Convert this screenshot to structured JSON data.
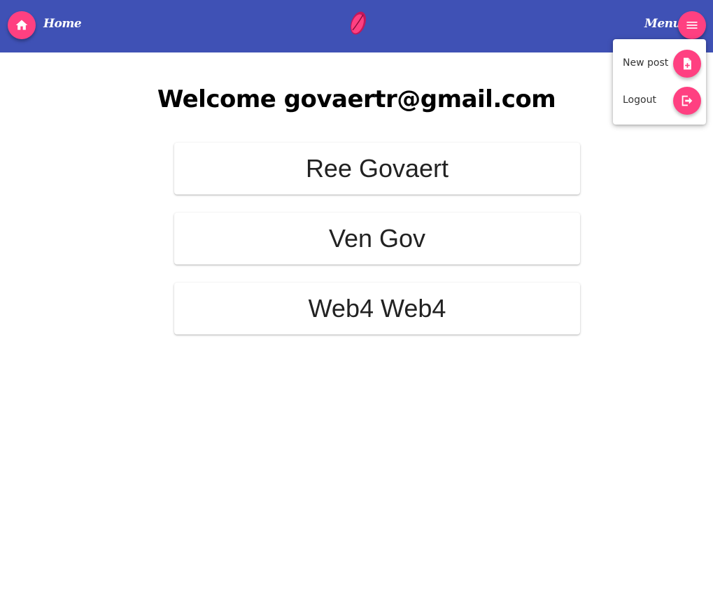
{
  "header": {
    "home_label": "Home",
    "menu_label": "Menu",
    "home_icon": "home-icon",
    "menu_icon": "hamburger-menu-icon",
    "logo_icon": "pink-leaf-logo"
  },
  "menu": {
    "items": [
      {
        "label": "New post",
        "icon": "new-document-icon"
      },
      {
        "label": "Logout",
        "icon": "logout-icon"
      }
    ]
  },
  "main": {
    "welcome": "Welcome govaertr@gmail.com",
    "users": [
      {
        "name": "Ree Govaert"
      },
      {
        "name": "Ven Gov"
      },
      {
        "name": "Web4 Web4"
      }
    ]
  },
  "colors": {
    "primary": "#3f51b5",
    "accent": "#ff4081"
  }
}
